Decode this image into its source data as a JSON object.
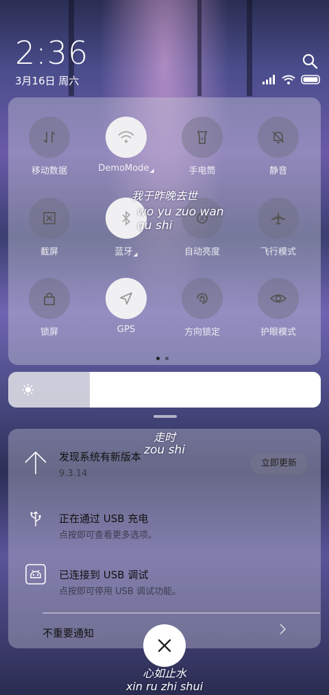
{
  "status": {
    "time": "2:36",
    "date": "3月16日 周六"
  },
  "quick_toggles": [
    {
      "label": "移动数据",
      "icon": "mobile-data-icon",
      "on": false,
      "expandable": false
    },
    {
      "label": "DemoMode",
      "icon": "wifi-icon",
      "on": true,
      "expandable": true
    },
    {
      "label": "手电筒",
      "icon": "flashlight-icon",
      "on": false,
      "expandable": false
    },
    {
      "label": "静音",
      "icon": "mute-icon",
      "on": false,
      "expandable": false
    },
    {
      "label": "截屏",
      "icon": "screenshot-icon",
      "on": false,
      "expandable": false
    },
    {
      "label": "蓝牙",
      "icon": "bluetooth-icon",
      "on": true,
      "expandable": true
    },
    {
      "label": "自动亮度",
      "icon": "auto-brightness-icon",
      "on": false,
      "expandable": false
    },
    {
      "label": "飞行模式",
      "icon": "airplane-icon",
      "on": false,
      "expandable": false
    },
    {
      "label": "锁屏",
      "icon": "lock-icon",
      "on": false,
      "expandable": false
    },
    {
      "label": "GPS",
      "icon": "gps-icon",
      "on": true,
      "expandable": false
    },
    {
      "label": "方向锁定",
      "icon": "rotation-lock-icon",
      "on": false,
      "expandable": false
    },
    {
      "label": "护眼模式",
      "icon": "eye-icon",
      "on": false,
      "expandable": false
    }
  ],
  "brightness": {
    "level": 0.26
  },
  "notifications": {
    "update": {
      "title": "发现系统有新版本",
      "subtitle": "9.3.14",
      "button": "立即更新"
    },
    "usb_charge": {
      "title": "正在通过 USB 充电",
      "subtitle": "点按即可查看更多选项。"
    },
    "usb_debug": {
      "title": "已连接到 USB 调试",
      "subtitle": "点按即可停用 USB 调试功能。"
    },
    "minor_label": "不重要通知"
  },
  "wallpaper_lyrics": {
    "line1": "我于昨晚去世",
    "line1_pinyin": "wo yu zuo wan qu shi",
    "line2": "走时",
    "line2_pinyin": "zou shi",
    "line3": "心如止水",
    "line3_pinyin": "xin ru zhi shui"
  }
}
